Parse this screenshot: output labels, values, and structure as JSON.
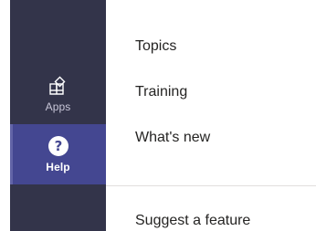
{
  "rail": {
    "items": [
      {
        "label": "Apps",
        "icon": "apps-icon",
        "active": false
      },
      {
        "label": "Help",
        "icon": "help-icon",
        "active": true
      }
    ]
  },
  "menu": {
    "items": [
      {
        "label": "Topics"
      },
      {
        "label": "Training"
      },
      {
        "label": "What's new"
      },
      {
        "label": "Suggest a feature"
      }
    ]
  },
  "colors": {
    "rail_bg": "#33344a",
    "active_bg": "#444791",
    "active_indicator": "#6264a7",
    "menu_text": "#252423",
    "divider": "#e1dfdd"
  }
}
